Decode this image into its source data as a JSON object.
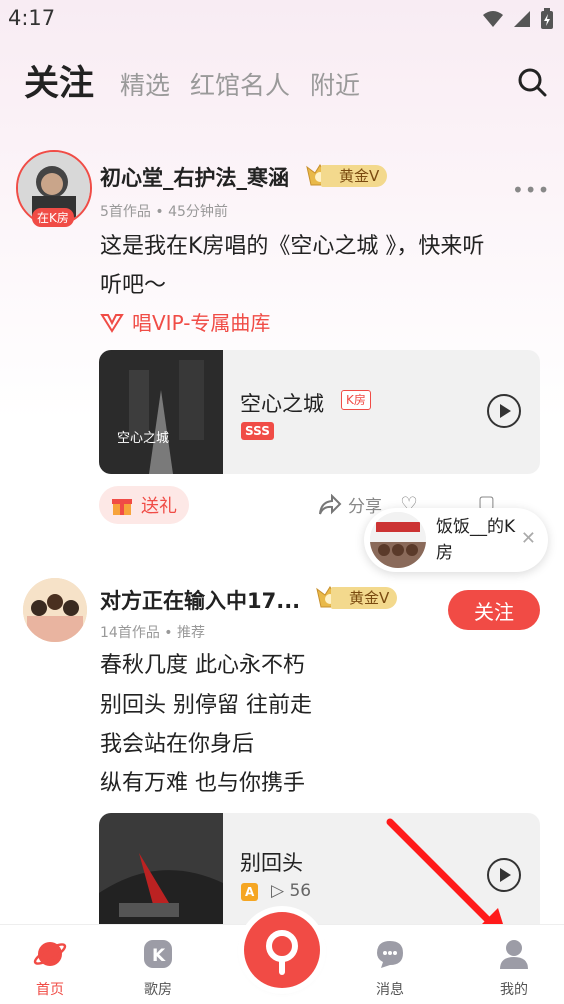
{
  "status_bar": {
    "time": "4:17"
  },
  "tabs": [
    {
      "label": "关注",
      "active": true
    },
    {
      "label": "精选",
      "active": false
    },
    {
      "label": "红馆名人",
      "active": false
    },
    {
      "label": "附近",
      "active": false
    }
  ],
  "posts": [
    {
      "username": "初心堂_右护法_寒涵",
      "avatar_badge": "在K房",
      "vip_label": "黄金V",
      "meta": "5首作品 • 45分钟前",
      "text_lines": [
        "这是我在K房唱的《空心之城 》，快来听",
        "听吧～"
      ],
      "vip_link": "唱VIP-专属曲库",
      "song": {
        "title": "空心之城",
        "tag": "K房",
        "grade": "SSS"
      },
      "gift_label": "送礼",
      "actions": {
        "share": "分享",
        "like": "点赞",
        "comment": "评论"
      }
    },
    {
      "username": "对方正在输入中17...",
      "vip_label": "黄金V",
      "meta": "14首作品 • 推荐",
      "follow_label": "关注",
      "text_lines": [
        "春秋几度 此心永不朽",
        "别回头 别停留 往前走",
        "我会站在你身后",
        "纵有万难 也与你携手"
      ],
      "song": {
        "title": "别回头",
        "tag": "A",
        "plays": "56"
      }
    }
  ],
  "popup": {
    "text": "饭饭__的K房"
  },
  "bottom_nav": [
    {
      "label": "首页",
      "icon": "planet-icon",
      "active": true
    },
    {
      "label": "歌房",
      "icon": "k-room-icon",
      "active": false
    },
    {
      "label": "",
      "icon": "microphone-icon",
      "active": false
    },
    {
      "label": "消息",
      "icon": "chat-bubble-icon",
      "active": false
    },
    {
      "label": "我的",
      "icon": "person-icon",
      "active": false
    }
  ],
  "colors": {
    "accent": "#f14b45",
    "vip_gold": "#f3d98d",
    "tab_inactive": "#9a9a9a"
  }
}
